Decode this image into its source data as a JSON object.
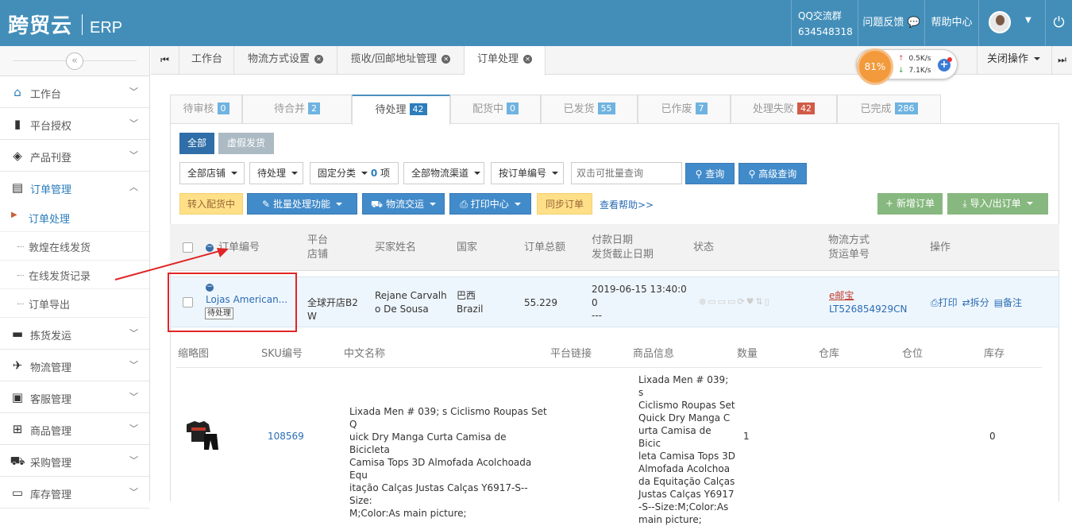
{
  "header": {
    "logo": "跨贸云",
    "logo_suffix": "ERP",
    "qq_label": "QQ交流群",
    "qq_number": "634548318",
    "feedback": "问题反馈",
    "help_center": "帮助中心"
  },
  "sidebar": {
    "collapse_glyph": "«",
    "items": [
      {
        "label": "工作台",
        "icon": "home-icon"
      },
      {
        "label": "平台授权",
        "icon": "bookmark-icon"
      },
      {
        "label": "产品刊登",
        "icon": "cube-icon"
      },
      {
        "label": "订单管理",
        "icon": "file-icon"
      }
    ],
    "sub_items": [
      "订单处理",
      "敦煌在线发货",
      "在线发货记录",
      "订单导出"
    ],
    "items_bottom": [
      {
        "label": "拣货发运",
        "icon": "truck-icon"
      },
      {
        "label": "物流管理",
        "icon": "plane-icon"
      },
      {
        "label": "客服管理",
        "icon": "briefcase-icon"
      },
      {
        "label": "商品管理",
        "icon": "gift-icon"
      },
      {
        "label": "采购管理",
        "icon": "cart-icon"
      },
      {
        "label": "库存管理",
        "icon": "inbox-icon"
      }
    ]
  },
  "page_tabs": [
    "工作台",
    "物流方式设置",
    "揽收/回邮地址管理",
    "订单处理"
  ],
  "close_ops": "关闭操作",
  "widget": {
    "percent": "81%",
    "up": "0.5K/s",
    "down": "7.1K/s"
  },
  "status_tabs": [
    {
      "label": "待审核",
      "count": "0"
    },
    {
      "label": "待合并",
      "count": "2"
    },
    {
      "label": "待处理",
      "count": "42"
    },
    {
      "label": "配货中",
      "count": "0"
    },
    {
      "label": "已发货",
      "count": "55"
    },
    {
      "label": "已作废",
      "count": "7"
    },
    {
      "label": "处理失败",
      "count": "42"
    },
    {
      "label": "已完成",
      "count": "286"
    }
  ],
  "filters": {
    "all": "全部",
    "virtual": "虚假发货",
    "shop": "全部店铺",
    "state": "待处理",
    "category": "固定分类",
    "category_count": "0",
    "category_unit": "项",
    "channel": "全部物流渠道",
    "by_order": "按订单编号",
    "search_placeholder": "双击可批量查询",
    "query": "查询",
    "advanced": "高级查询"
  },
  "actions": {
    "to_allocation": "转入配货中",
    "batch": "批量处理功能",
    "logistics": "物流交运",
    "print": "打印中心",
    "sync": "同步订单",
    "help": "查看帮助>>",
    "new_order": "新增订单",
    "import_export": "导入/出订单"
  },
  "table_headers": {
    "order_no": "订单编号",
    "platform_1": "平台",
    "platform_2": "店铺",
    "buyer": "买家姓名",
    "country": "国家",
    "total": "订单总额",
    "pay_date": "付款日期",
    "ship_deadline": "发货截止日期",
    "state": "状态",
    "method": "物流方式",
    "tracking": "货运单号",
    "ops": "操作"
  },
  "order": {
    "order_no": "Lojas American...",
    "status": "待处理",
    "shop_1": "全球开店B2",
    "shop_2": "W",
    "buyer_1": "Rejane Carvalh",
    "buyer_2": "o De Sousa",
    "country_cn": "巴西",
    "country_en": "Brazil",
    "total": "55.229",
    "pay_date_1": "2019-06-15 13:40:0",
    "pay_date_2": "0",
    "deadline": "---",
    "method": "e邮宝",
    "tracking": "LT526854929CN",
    "op_print": "打印",
    "op_split": "拆分",
    "op_note": "备注"
  },
  "sku_headers": [
    "缩略图",
    "SKU编号",
    "中文名称",
    "平台链接",
    "商品信息",
    "数量",
    "仓库",
    "仓位",
    "库存"
  ],
  "sku": {
    "sku_no": "108569",
    "name_lines": [
      "Lixada Men # 039; s Ciclismo Roupas Set Q",
      "uick Dry Manga Curta Camisa de Bicicleta",
      "Camisa Tops 3D Almofada Acolchoada Equ",
      "itação Calças Justas Calças Y6917-S--Size:",
      "M;Color:As main picture;"
    ],
    "info_lines": [
      "Lixada Men # 039; s",
      "Ciclismo Roupas Set",
      "Quick Dry Manga C",
      "urta Camisa de Bicic",
      "leta Camisa Tops 3D",
      "Almofada Acolchoa",
      "da Equitação Calças",
      "Justas Calças Y6917",
      "-S--Size:M;Color:As",
      "main picture;"
    ],
    "qty": "1",
    "stock": "0"
  }
}
